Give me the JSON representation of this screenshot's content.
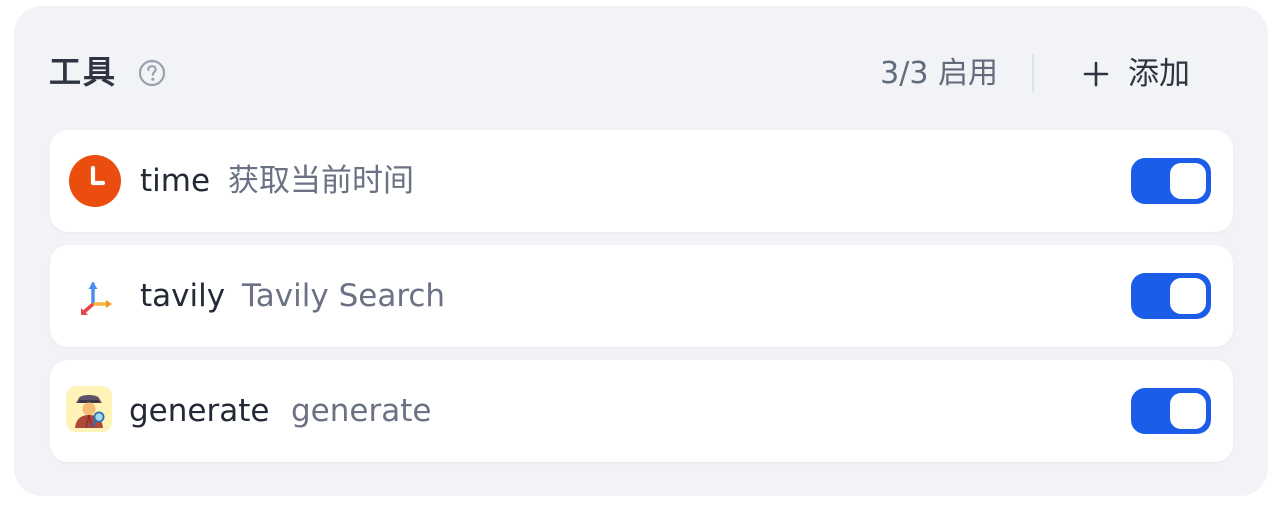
{
  "header": {
    "title": "工具",
    "help_icon": "question-circle-icon",
    "enabled_count": "3/3 启用",
    "add_label": "添加",
    "add_icon": "plus-icon"
  },
  "tools": [
    {
      "name": "time",
      "description": "获取当前时间",
      "icon": "clock-icon",
      "enabled": true
    },
    {
      "name": "tavily",
      "description": "Tavily Search",
      "icon": "tavily-logo-icon",
      "enabled": true
    },
    {
      "name": "generate",
      "description": "generate",
      "icon": "detective-icon",
      "enabled": true
    }
  ],
  "colors": {
    "accent": "#1b5de8",
    "panel_bg": "#f2f3f7",
    "clock_orange": "#ea4d0e"
  }
}
